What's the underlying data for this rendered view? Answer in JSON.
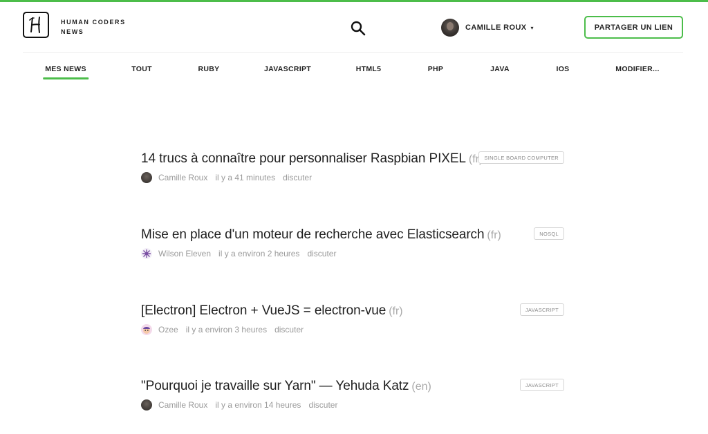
{
  "brand": {
    "line1": "HUMAN CODERS",
    "line2": "NEWS"
  },
  "user": {
    "name": "CAMILLE ROUX",
    "caret": "▾"
  },
  "share_button": "PARTAGER UN LIEN",
  "colors": {
    "accent": "#4cbd4a",
    "text": "#222222",
    "muted": "#9a9a9a"
  },
  "nav": [
    {
      "label": "MES NEWS",
      "active": true
    },
    {
      "label": "TOUT"
    },
    {
      "label": "RUBY"
    },
    {
      "label": "JAVASCRIPT"
    },
    {
      "label": "HTML5"
    },
    {
      "label": "PHP"
    },
    {
      "label": "JAVA"
    },
    {
      "label": "IOS"
    },
    {
      "label": "MODIFIER..."
    }
  ],
  "articles": [
    {
      "title": "14 trucs à connaître pour personnaliser Raspbian PIXEL",
      "lang": "(fr)",
      "tag": "SINGLE BOARD COMPUTER",
      "author": "Camille Roux",
      "time": "il y a 41 minutes",
      "discuss": "discuter"
    },
    {
      "title": "Mise en place d'un moteur de recherche avec Elasticsearch",
      "lang": "(fr)",
      "tag": "NOSQL",
      "author": "Wilson Eleven",
      "time": "il y a environ 2 heures",
      "discuss": "discuter"
    },
    {
      "title": "[Electron] Electron + VueJS = electron-vue",
      "lang": "(fr)",
      "tag": "JAVASCRIPT",
      "author": "Ozee",
      "time": "il y a environ 3 heures",
      "discuss": "discuter"
    },
    {
      "title": "\"Pourquoi je travaille sur Yarn\" — Yehuda Katz",
      "lang": "(en)",
      "tag": "JAVASCRIPT",
      "author": "Camille Roux",
      "time": "il y a environ 14 heures",
      "discuss": "discuter"
    }
  ]
}
